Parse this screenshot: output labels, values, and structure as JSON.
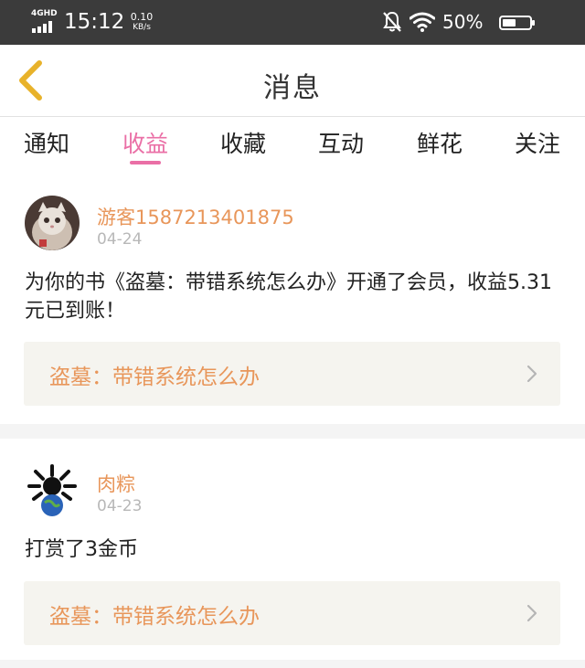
{
  "status_bar": {
    "network": "4GHD",
    "time": "15:12",
    "speed_value": "0.10",
    "speed_unit": "KB/s",
    "battery": "50%",
    "icons": [
      "signal-icon",
      "mute-bell-icon",
      "wifi-icon",
      "battery-icon"
    ]
  },
  "header": {
    "title": "消息",
    "back_icon": "chevron-left-icon"
  },
  "tabs": [
    {
      "label": "通知",
      "active": false
    },
    {
      "label": "收益",
      "active": true
    },
    {
      "label": "收藏",
      "active": false
    },
    {
      "label": "互动",
      "active": false
    },
    {
      "label": "鲜花",
      "active": false
    },
    {
      "label": "关注",
      "active": false
    }
  ],
  "messages": [
    {
      "username": "游客1587213401875",
      "date": "04-24",
      "text": "为你的书《盗墓：带错系统怎么办》开通了会员，收益5.31元已到账！",
      "book_title": "盗墓：带错系统怎么办"
    },
    {
      "username": "肉粽",
      "date": "04-23",
      "text": "打赏了3金币",
      "book_title": "盗墓：带错系统怎么办"
    }
  ],
  "colors": {
    "accent_pink": "#ea6fa6",
    "accent_orange": "#e8965a",
    "back_icon_yellow": "#e8b22a",
    "status_bar_bg": "#3b3b3b"
  }
}
